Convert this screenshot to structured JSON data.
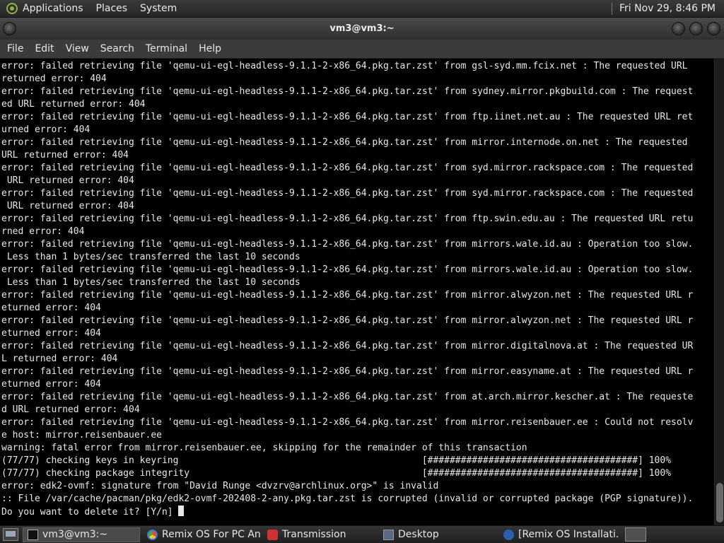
{
  "top_panel": {
    "menus": [
      "Applications",
      "Places",
      "System"
    ],
    "clock": "Fri Nov 29,  8:46 PM"
  },
  "window": {
    "title": "vm3@vm3:~"
  },
  "menubar": {
    "items": [
      "File",
      "Edit",
      "View",
      "Search",
      "Terminal",
      "Help"
    ]
  },
  "terminal": {
    "lines": [
      "error: failed retrieving file 'qemu-ui-egl-headless-9.1.1-2-x86_64.pkg.tar.zst' from gsl-syd.mm.fcix.net : The requested URL",
      "returned error: 404",
      "error: failed retrieving file 'qemu-ui-egl-headless-9.1.1-2-x86_64.pkg.tar.zst' from sydney.mirror.pkgbuild.com : The request",
      "ed URL returned error: 404",
      "error: failed retrieving file 'qemu-ui-egl-headless-9.1.1-2-x86_64.pkg.tar.zst' from ftp.iinet.net.au : The requested URL ret",
      "urned error: 404",
      "error: failed retrieving file 'qemu-ui-egl-headless-9.1.1-2-x86_64.pkg.tar.zst' from mirror.internode.on.net : The requested",
      "URL returned error: 404",
      "error: failed retrieving file 'qemu-ui-egl-headless-9.1.1-2-x86_64.pkg.tar.zst' from syd.mirror.rackspace.com : The requested",
      " URL returned error: 404",
      "error: failed retrieving file 'qemu-ui-egl-headless-9.1.1-2-x86_64.pkg.tar.zst' from syd.mirror.rackspace.com : The requested",
      " URL returned error: 404",
      "error: failed retrieving file 'qemu-ui-egl-headless-9.1.1-2-x86_64.pkg.tar.zst' from ftp.swin.edu.au : The requested URL retu",
      "rned error: 404",
      "error: failed retrieving file 'qemu-ui-egl-headless-9.1.1-2-x86_64.pkg.tar.zst' from mirrors.wale.id.au : Operation too slow.",
      " Less than 1 bytes/sec transferred the last 10 seconds",
      "error: failed retrieving file 'qemu-ui-egl-headless-9.1.1-2-x86_64.pkg.tar.zst' from mirrors.wale.id.au : Operation too slow.",
      " Less than 1 bytes/sec transferred the last 10 seconds",
      "error: failed retrieving file 'qemu-ui-egl-headless-9.1.1-2-x86_64.pkg.tar.zst' from mirror.alwyzon.net : The requested URL r",
      "eturned error: 404",
      "error: failed retrieving file 'qemu-ui-egl-headless-9.1.1-2-x86_64.pkg.tar.zst' from mirror.alwyzon.net : The requested URL r",
      "eturned error: 404",
      "error: failed retrieving file 'qemu-ui-egl-headless-9.1.1-2-x86_64.pkg.tar.zst' from mirror.digitalnova.at : The requested UR",
      "L returned error: 404",
      "error: failed retrieving file 'qemu-ui-egl-headless-9.1.1-2-x86_64.pkg.tar.zst' from mirror.easyname.at : The requested URL r",
      "eturned error: 404",
      "error: failed retrieving file 'qemu-ui-egl-headless-9.1.1-2-x86_64.pkg.tar.zst' from at.arch.mirror.kescher.at : The requeste",
      "d URL returned error: 404",
      "error: failed retrieving file 'qemu-ui-egl-headless-9.1.1-2-x86_64.pkg.tar.zst' from mirror.reisenbauer.ee : Could not resolv",
      "e host: mirror.reisenbauer.ee",
      "warning: fatal error from mirror.reisenbauer.ee, skipping for the remainder of this transaction",
      "(77/77) checking keys in keyring                                            [######################################] 100%",
      "(77/77) checking package integrity                                          [######################################] 100%",
      "error: edk2-ovmf: signature from \"David Runge <dvzrv@archlinux.org>\" is invalid",
      ":: File /var/cache/pacman/pkg/edk2-ovmf-202408-2-any.pkg.tar.zst is corrupted (invalid or corrupted package (PGP signature)).",
      "Do you want to delete it? [Y/n] "
    ]
  },
  "taskbar": {
    "tasks": [
      {
        "label": "vm3@vm3:~",
        "icon": "terminal-icon"
      },
      {
        "label": "Remix OS For PC An...",
        "icon": "chrome-icon"
      },
      {
        "label": "Transmission",
        "icon": "transmission-icon"
      },
      {
        "label": "Desktop",
        "icon": "folder-icon"
      },
      {
        "label": "[Remix OS Installati...",
        "icon": "app-icon"
      }
    ]
  }
}
